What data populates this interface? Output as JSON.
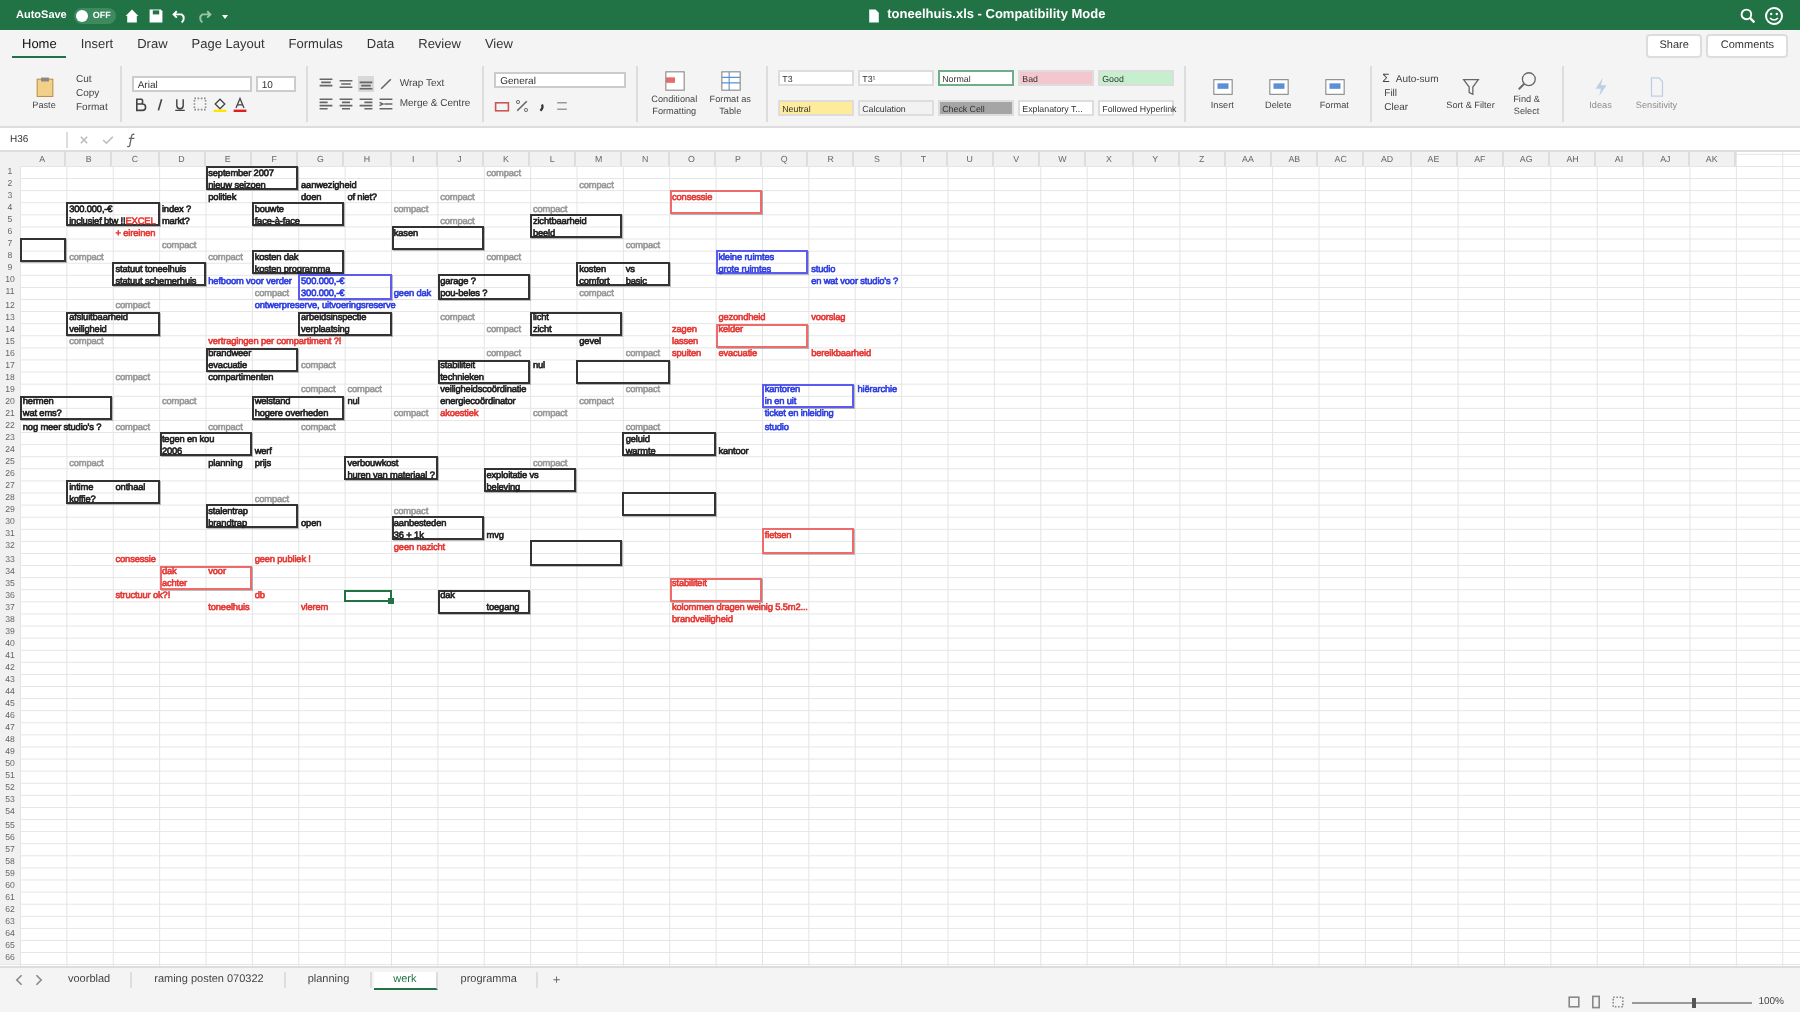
{
  "title_bar": {
    "autosave_label": "AutoSave",
    "autosave": {
      "on": false,
      "label": "OFF"
    },
    "title": "toneelhuis.xls  -  Compatibility Mode"
  },
  "tabs": [
    {
      "label": "Home",
      "selected": true
    },
    {
      "label": "Insert",
      "selected": false
    },
    {
      "label": "Draw",
      "selected": false
    },
    {
      "label": "Page Layout",
      "selected": false
    },
    {
      "label": "Formulas",
      "selected": false
    },
    {
      "label": "Data",
      "selected": false
    },
    {
      "label": "Review",
      "selected": false
    },
    {
      "label": "View",
      "selected": false
    }
  ],
  "share": "Share",
  "comments": "Comments",
  "ribbon": {
    "paste": "Paste",
    "cut": "Cut",
    "copy": "Copy",
    "format_painter": "Format",
    "font_name": "Arial",
    "font_size": "10",
    "wrap_text": "Wrap Text",
    "merge": "Merge & Centre",
    "number_format": "General",
    "conditional": "Conditional Formatting",
    "format_table": "Format as Table",
    "styles": [
      {
        "label": "T3",
        "color": "#ffffff",
        "selected": false
      },
      {
        "label": "T3¹",
        "color": "#ffffff",
        "selected": false
      },
      {
        "label": "Normal",
        "color": "#ffffff",
        "selected": true
      },
      {
        "label": "Bad",
        "color": "#f4c7ce",
        "selected": false
      },
      {
        "label": "Good",
        "color": "#c6efce",
        "selected": false
      },
      {
        "label": "Neutral",
        "color": "#ffeb9c",
        "selected": false
      },
      {
        "label": "Calculation",
        "color": "#f2f2f2",
        "selected": false
      },
      {
        "label": "Check Cell",
        "color": "#a5a5a5",
        "selected": false
      },
      {
        "label": "Explanatory T...",
        "color": "#ffffff",
        "selected": false
      },
      {
        "label": "Followed Hyperlink",
        "color": "#ffffff",
        "selected": false
      }
    ],
    "cells": [
      "Insert",
      "Delete",
      "Format"
    ],
    "autosum_symbol": "Σ",
    "autosum": "Auto-sum",
    "fill": "Fill",
    "clear": "Clear",
    "sort": "Sort & Filter",
    "find": "Find & Select",
    "ideas": "Ideas",
    "sensitivity": "Sensitivity"
  },
  "formula_bar": {
    "name_box": "H36"
  },
  "sheet": {
    "columns": [
      "A",
      "B",
      "C",
      "D",
      "E",
      "F",
      "G",
      "H",
      "I",
      "J",
      "K",
      "L",
      "M",
      "N",
      "O",
      "P",
      "Q",
      "R",
      "S",
      "T",
      "U",
      "V",
      "W",
      "X",
      "Y",
      "Z",
      "AA",
      "AB",
      "AC",
      "AD",
      "AE",
      "AF",
      "AG",
      "AH",
      "AI",
      "AJ",
      "AK"
    ],
    "rows": [
      {
        "label": "1",
        "cells": [
          {},
          {},
          {},
          {},
          {
            "text": "september 2007",
            "color": "#222222",
            "outline": {
              "color": "#333333",
              "wide": true
            }
          },
          {},
          {},
          {},
          {},
          {},
          {
            "text": "compact",
            "color": "#9a9a9a"
          }
        ]
      },
      {
        "label": "2",
        "cells": [
          {},
          {},
          {},
          {},
          {
            "text": "nieuw seizoen",
            "color": "#222222"
          },
          {},
          {
            "text": "aanwezigheid",
            "color": "#222222"
          },
          {},
          {},
          {},
          {},
          {},
          {
            "text": "compact",
            "color": "#9a9a9a"
          }
        ]
      },
      {
        "label": "3",
        "cells": [
          {},
          {},
          {},
          {},
          {
            "text": "politiek",
            "color": "#222222"
          },
          {},
          {
            "text": "doen",
            "color": "#222222"
          },
          {
            "text": "of niet?",
            "color": "#222222"
          },
          {},
          {
            "text": "compact",
            "color": "#9a9a9a"
          },
          {},
          {},
          {},
          {},
          {
            "text": "consessie",
            "color": "#e53935",
            "outline": {
              "color": "#ee6b6b",
              "wide": true
            }
          }
        ]
      },
      {
        "label": "4",
        "cells": [
          {},
          {
            "text": "300.000,-€",
            "color": "#222222",
            "outline": {
              "color": "#333333",
              "wide": true
            }
          },
          {},
          {
            "text": "index ?",
            "color": "#222222"
          },
          {},
          {
            "text": "bouwte",
            "color": "#222222",
            "outline": {
              "color": "#333333",
              "wide": true
            }
          },
          {},
          {},
          {
            "text": "compact",
            "color": "#9a9a9a"
          },
          {},
          {},
          {
            "text": "compact",
            "color": "#9a9a9a"
          }
        ]
      },
      {
        "label": "5",
        "cells": [
          {},
          {
            "text": "inclusief btw !!",
            "color": "#222222",
            "tail": {
              "text": "EXCEL",
              "color": "#e53935"
            }
          },
          {},
          {
            "text": "markt?",
            "color": "#222222"
          },
          {},
          {
            "text": "face-à-face",
            "color": "#222222"
          },
          {},
          {},
          {},
          {
            "text": "compact",
            "color": "#9a9a9a"
          },
          {},
          {
            "text": "zichtbaarheid",
            "color": "#222222",
            "outline": {
              "color": "#333333",
              "wide": true
            }
          }
        ]
      },
      {
        "label": "6",
        "cells": [
          {},
          {},
          {
            "text": "+ eireinen",
            "color": "#e53935"
          },
          {},
          {},
          {},
          {},
          {},
          {
            "text": "kasen",
            "color": "#222222",
            "outline": {
              "color": "#333333",
              "wide": true
            }
          },
          {},
          {},
          {
            "text": "beeld",
            "color": "#222222"
          }
        ]
      },
      {
        "label": "7",
        "cells": [
          {
            "outline": {
              "color": "#333333",
              "wide": false
            }
          },
          {},
          {},
          {
            "text": "compact",
            "color": "#9a9a9a"
          },
          {},
          {},
          {},
          {},
          {},
          {},
          {},
          {},
          {},
          {
            "text": "compact",
            "color": "#9a9a9a"
          }
        ]
      },
      {
        "label": "8",
        "cells": [
          {},
          {
            "text": "compact",
            "color": "#9a9a9a"
          },
          {},
          {},
          {
            "text": "compact",
            "color": "#9a9a9a"
          },
          {
            "text": "kosten dak",
            "color": "#222222",
            "outline": {
              "color": "#333333",
              "wide": true
            }
          },
          {},
          {},
          {},
          {},
          {
            "text": "compact",
            "color": "#9a9a9a"
          },
          {},
          {},
          {},
          {},
          {
            "text": "kleine ruimtes",
            "color": "#2f3fe0",
            "outline": {
              "color": "#5b5bef",
              "wide": true
            }
          }
        ]
      },
      {
        "label": "9",
        "cells": [
          {},
          {},
          {
            "text": "statuut toneelhuis",
            "color": "#222222",
            "outline": {
              "color": "#333333",
              "wide": true
            }
          },
          {},
          {},
          {
            "text": "kosten programma",
            "color": "#222222"
          },
          {},
          {},
          {},
          {},
          {},
          {},
          {
            "text": "kosten",
            "color": "#222222",
            "outline": {
              "color": "#333333",
              "wide": true
            }
          },
          {
            "text": "vs",
            "color": "#222222"
          },
          {},
          {
            "text": "grote ruimtes",
            "color": "#2f3fe0"
          },
          {},
          {
            "text": "studio",
            "color": "#2f3fe0"
          }
        ]
      },
      {
        "label": "10",
        "cells": [
          {},
          {},
          {
            "text": "statuut schemerhuis",
            "color": "#222222"
          },
          {},
          {
            "text": "hefboom voor verder",
            "color": "#2f3fe0"
          },
          {},
          {
            "text": "500.000,-€",
            "color": "#2f3fe0",
            "outline": {
              "color": "#5b5bef",
              "wide": true
            }
          },
          {},
          {},
          {
            "text": "garage ?",
            "color": "#222222",
            "outline": {
              "color": "#333333",
              "wide": true
            }
          },
          {},
          {},
          {
            "text": "comfort",
            "color": "#222222"
          },
          {
            "text": "basic",
            "color": "#222222"
          },
          {},
          {},
          {},
          {
            "text": "en wat voor studio's ?",
            "color": "#2f3fe0"
          }
        ]
      },
      {
        "label": "11",
        "cells": [
          {},
          {},
          {},
          {},
          {},
          {
            "text": "compact",
            "color": "#9a9a9a"
          },
          {
            "text": "300.000,-€",
            "color": "#2f3fe0"
          },
          {},
          {
            "text": "geen dak",
            "color": "#2f3fe0"
          },
          {
            "text": "pou-beles ?",
            "color": "#222222"
          },
          {},
          {},
          {
            "text": "compact",
            "color": "#9a9a9a"
          }
        ]
      },
      {
        "label": "12",
        "cells": [
          {},
          {},
          {
            "text": "compact",
            "color": "#9a9a9a"
          },
          {},
          {},
          {
            "text": "ontwerpreserve, uitvoeringsreserve",
            "color": "#2f3fe0"
          }
        ]
      },
      {
        "label": "13",
        "cells": [
          {},
          {
            "text": "afsluitbaarheid",
            "color": "#222222",
            "outline": {
              "color": "#333333",
              "wide": true
            }
          },
          {},
          {},
          {},
          {},
          {
            "text": "arbeidsinspectie",
            "color": "#222222",
            "outline": {
              "color": "#333333",
              "wide": true
            }
          },
          {},
          {},
          {
            "text": "compact",
            "color": "#9a9a9a"
          },
          {},
          {
            "text": "licht",
            "color": "#222222",
            "outline": {
              "color": "#333333",
              "wide": true
            }
          },
          {},
          {},
          {},
          {
            "text": "gezondheid",
            "color": "#e53935"
          },
          {},
          {
            "text": "voorslag",
            "color": "#e53935"
          }
        ]
      },
      {
        "label": "14",
        "cells": [
          {},
          {
            "text": "veiligheid",
            "color": "#222222"
          },
          {},
          {},
          {},
          {},
          {
            "text": "verplaatsing",
            "color": "#222222"
          },
          {},
          {},
          {},
          {
            "text": "compact",
            "color": "#9a9a9a"
          },
          {
            "text": "zicht",
            "color": "#222222"
          },
          {},
          {},
          {
            "text": "zagen",
            "color": "#e53935"
          },
          {
            "text": "kelder",
            "color": "#e53935",
            "outline": {
              "color": "#ee6b6b",
              "wide": true
            }
          }
        ]
      },
      {
        "label": "15",
        "cells": [
          {},
          {
            "text": "compact",
            "color": "#9a9a9a"
          },
          {},
          {},
          {
            "text": "vertragingen per compartiment ?!",
            "color": "#e53935"
          },
          {},
          {},
          {},
          {},
          {},
          {},
          {},
          {
            "text": "gevel",
            "color": "#222222"
          },
          {},
          {
            "text": "lassen",
            "color": "#e53935"
          }
        ]
      },
      {
        "label": "16",
        "cells": [
          {},
          {},
          {},
          {},
          {
            "text": "brandweer",
            "color": "#222222",
            "outline": {
              "color": "#333333",
              "wide": true
            }
          },
          {},
          {},
          {},
          {},
          {},
          {
            "text": "compact",
            "color": "#9a9a9a"
          },
          {},
          {},
          {
            "text": "compact",
            "color": "#9a9a9a"
          },
          {
            "text": "spuiten",
            "color": "#e53935"
          },
          {
            "text": "evacuatie",
            "color": "#e53935"
          },
          {},
          {
            "text": "bereikbaarheid",
            "color": "#e53935"
          }
        ]
      },
      {
        "label": "17",
        "cells": [
          {},
          {},
          {},
          {},
          {
            "text": "evacuatie",
            "color": "#222222"
          },
          {},
          {
            "text": "compact",
            "color": "#9a9a9a"
          },
          {},
          {},
          {
            "text": "stabiliteit",
            "color": "#222222",
            "outline": {
              "color": "#333333",
              "wide": true
            }
          },
          {},
          {
            "text": "nul",
            "color": "#222222"
          },
          {
            "outline": {
              "color": "#333333",
              "wide": true
            }
          }
        ]
      },
      {
        "label": "18",
        "cells": [
          {},
          {},
          {
            "text": "compact",
            "color": "#9a9a9a"
          },
          {},
          {
            "text": "compartimenten",
            "color": "#222222"
          },
          {},
          {},
          {},
          {},
          {
            "text": "technieken",
            "color": "#222222"
          }
        ]
      },
      {
        "label": "19",
        "cells": [
          {},
          {},
          {},
          {},
          {},
          {},
          {
            "text": "compact",
            "color": "#9a9a9a"
          },
          {
            "text": "compact",
            "color": "#9a9a9a"
          },
          {},
          {
            "text": "veiligheidscoördinatie",
            "color": "#222222"
          },
          {},
          {},
          {},
          {
            "text": "compact",
            "color": "#9a9a9a"
          },
          {},
          {},
          {
            "text": "kantoren",
            "color": "#2f3fe0",
            "outline": {
              "color": "#5b5bef",
              "wide": true
            }
          },
          {},
          {
            "text": "hiërarchie",
            "color": "#2f3fe0"
          }
        ]
      },
      {
        "label": "20",
        "cells": [
          {
            "text": "hermen",
            "color": "#222222",
            "outline": {
              "color": "#333333",
              "wide": true
            }
          },
          {},
          {},
          {
            "text": "compact",
            "color": "#9a9a9a"
          },
          {},
          {
            "text": "welstand",
            "color": "#222222",
            "outline": {
              "color": "#333333",
              "wide": true
            }
          },
          {},
          {
            "text": "nul",
            "color": "#222222"
          },
          {},
          {
            "text": "energiecoördinator",
            "color": "#222222"
          },
          {},
          {},
          {
            "text": "compact",
            "color": "#9a9a9a"
          },
          {},
          {},
          {},
          {
            "text": "in en uit",
            "color": "#2f3fe0"
          }
        ]
      },
      {
        "label": "21",
        "cells": [
          {
            "text": "wat ems?",
            "color": "#222222"
          },
          {},
          {},
          {},
          {},
          {
            "text": "hogere overheden",
            "color": "#222222"
          },
          {},
          {},
          {
            "text": "compact",
            "color": "#9a9a9a"
          },
          {
            "text": "akoestiek",
            "color": "#e53935"
          },
          {},
          {
            "text": "compact",
            "color": "#9a9a9a"
          },
          {},
          {},
          {},
          {},
          {
            "text": "ticket en inleiding",
            "color": "#2f3fe0"
          }
        ]
      },
      {
        "label": "22",
        "cells": [
          {
            "text": "nog meer studio's ?",
            "color": "#222222"
          },
          {},
          {
            "text": "compact",
            "color": "#9a9a9a"
          },
          {},
          {
            "text": "compact",
            "color": "#9a9a9a"
          },
          {},
          {
            "text": "compact",
            "color": "#9a9a9a"
          },
          {},
          {},
          {},
          {},
          {},
          {},
          {
            "text": "compact",
            "color": "#9a9a9a"
          },
          {},
          {},
          {
            "text": "studio",
            "color": "#2f3fe0"
          }
        ]
      },
      {
        "label": "23",
        "cells": [
          {},
          {},
          {},
          {
            "text": "tegen en kou",
            "color": "#222222",
            "outline": {
              "color": "#333333",
              "wide": true
            }
          },
          {},
          {},
          {},
          {},
          {},
          {},
          {},
          {},
          {},
          {
            "text": "geluid",
            "color": "#222222",
            "outline": {
              "color": "#333333",
              "wide": true
            }
          }
        ]
      },
      {
        "label": "24",
        "cells": [
          {},
          {},
          {},
          {
            "text": "2006",
            "color": "#222222"
          },
          {},
          {
            "text": "werf",
            "color": "#222222"
          },
          {},
          {},
          {},
          {},
          {},
          {},
          {},
          {
            "text": "warmte",
            "color": "#222222"
          },
          {},
          {
            "text": "kantoor",
            "color": "#222222"
          }
        ]
      },
      {
        "label": "25",
        "cells": [
          {},
          {
            "text": "compact",
            "color": "#9a9a9a"
          },
          {},
          {},
          {
            "text": "planning",
            "color": "#222222"
          },
          {
            "text": "prijs",
            "color": "#222222"
          },
          {},
          {
            "text": "verbouwkost",
            "color": "#222222",
            "outline": {
              "color": "#333333",
              "wide": true
            }
          },
          {},
          {},
          {},
          {
            "text": "compact",
            "color": "#9a9a9a"
          }
        ]
      },
      {
        "label": "26",
        "cells": [
          {},
          {},
          {},
          {},
          {},
          {},
          {},
          {
            "text": "huren van materiaal ?",
            "color": "#222222"
          },
          {},
          {},
          {
            "text": "exploitatie  vs",
            "color": "#222222",
            "outline": {
              "color": "#333333",
              "wide": true
            }
          }
        ]
      },
      {
        "label": "27",
        "cells": [
          {},
          {
            "text": "intime",
            "color": "#222222",
            "outline": {
              "color": "#333333",
              "wide": true
            }
          },
          {
            "text": "onthaal",
            "color": "#222222"
          },
          {},
          {},
          {},
          {},
          {},
          {},
          {},
          {
            "text": "beleving",
            "color": "#222222"
          }
        ]
      },
      {
        "label": "28",
        "cells": [
          {},
          {
            "text": "koffie?",
            "color": "#222222"
          },
          {},
          {},
          {},
          {
            "text": "compact",
            "color": "#9a9a9a"
          },
          {},
          {},
          {},
          {},
          {},
          {},
          {},
          {
            "outline": {
              "color": "#333333",
              "wide": true
            }
          }
        ]
      },
      {
        "label": "29",
        "cells": [
          {},
          {},
          {},
          {},
          {
            "text": "stalentrap",
            "color": "#222222",
            "outline": {
              "color": "#333333",
              "wide": true
            }
          },
          {},
          {},
          {},
          {
            "text": "compact",
            "color": "#9a9a9a"
          }
        ]
      },
      {
        "label": "30",
        "cells": [
          {},
          {},
          {},
          {},
          {
            "text": "brandtrap",
            "color": "#222222"
          },
          {},
          {
            "text": "open",
            "color": "#222222"
          },
          {},
          {
            "text": "aanbesteden",
            "color": "#222222",
            "outline": {
              "color": "#333333",
              "wide": true
            }
          }
        ]
      },
      {
        "label": "31",
        "cells": [
          {},
          {},
          {},
          {},
          {},
          {},
          {},
          {},
          {
            "text": "36 + 1k",
            "color": "#222222"
          },
          {},
          {
            "text": "mvg",
            "color": "#222222"
          },
          {},
          {},
          {},
          {},
          {},
          {
            "text": "fietsen",
            "color": "#e53935",
            "outline": {
              "color": "#ee6b6b",
              "wide": true
            }
          }
        ]
      },
      {
        "label": "32",
        "cells": [
          {},
          {},
          {},
          {},
          {},
          {},
          {},
          {},
          {
            "text": "geen nazicht",
            "color": "#e53935"
          },
          {},
          {},
          {
            "outline": {
              "color": "#333333",
              "wide": true
            }
          }
        ]
      },
      {
        "label": "33",
        "cells": [
          {},
          {},
          {
            "text": "consessie",
            "color": "#e53935"
          },
          {},
          {},
          {
            "text": "geen publiek !",
            "color": "#e53935"
          }
        ]
      },
      {
        "label": "34",
        "cells": [
          {},
          {},
          {},
          {
            "text": "dak",
            "color": "#e53935",
            "outline": {
              "color": "#ee6b6b",
              "wide": true
            }
          },
          {
            "text": "voor",
            "color": "#e53935"
          }
        ]
      },
      {
        "label": "35",
        "cells": [
          {},
          {},
          {},
          {
            "text": "achter",
            "color": "#e53935"
          },
          {},
          {},
          {},
          {},
          {},
          {},
          {},
          {},
          {},
          {},
          {
            "text": "stabiliteit",
            "color": "#e53935",
            "outline": {
              "color": "#ee6b6b",
              "wide": true
            }
          }
        ]
      },
      {
        "label": "36",
        "cells": [
          {},
          {},
          {
            "text": "structuur ok?!",
            "color": "#e53935"
          },
          {},
          {},
          {
            "text": "db",
            "color": "#e53935"
          },
          {},
          {
            "selected": true
          },
          {},
          {
            "text": "dak",
            "color": "#222222",
            "outline": {
              "color": "#333333",
              "wide": true
            }
          }
        ]
      },
      {
        "label": "37",
        "cells": [
          {},
          {},
          {},
          {},
          {
            "text": "toneelhuis",
            "color": "#e53935"
          },
          {},
          {
            "text": "vlerem",
            "color": "#e53935"
          },
          {},
          {},
          {},
          {
            "text": "toegang",
            "color": "#222222"
          },
          {},
          {},
          {},
          {
            "text": "kolommen dragen weinig 5.5m2...",
            "color": "#e53935"
          }
        ]
      },
      {
        "label": "38",
        "cells": [
          {},
          {},
          {},
          {},
          {},
          {},
          {},
          {},
          {},
          {},
          {},
          {},
          {},
          {},
          {
            "text": "brandveiligheid",
            "color": "#e53935"
          }
        ]
      },
      {
        "label": "39"
      },
      {
        "label": "40"
      },
      {
        "label": "41"
      },
      {
        "label": "42"
      },
      {
        "label": "43"
      },
      {
        "label": "44"
      },
      {
        "label": "45"
      },
      {
        "label": "46"
      },
      {
        "label": "47"
      },
      {
        "label": "48"
      },
      {
        "label": "49"
      },
      {
        "label": "50"
      },
      {
        "label": "51"
      },
      {
        "label": "52"
      },
      {
        "label": "53"
      },
      {
        "label": "54"
      },
      {
        "label": "55"
      },
      {
        "label": "56"
      },
      {
        "label": "57"
      },
      {
        "label": "58"
      },
      {
        "label": "59"
      },
      {
        "label": "60"
      },
      {
        "label": "61"
      },
      {
        "label": "62"
      },
      {
        "label": "63"
      },
      {
        "label": "64"
      },
      {
        "label": "65"
      },
      {
        "label": "66"
      }
    ]
  },
  "sheet_tabs": [
    {
      "label": "voorblad",
      "selected": false
    },
    {
      "label": "raming posten 070322",
      "selected": false
    },
    {
      "label": "planning",
      "selected": false
    },
    {
      "label": "werk",
      "selected": true
    },
    {
      "label": "programma",
      "selected": false
    }
  ],
  "add_sheet": "+",
  "status_bar": {
    "zoom_slider": {
      "level": 0.5
    },
    "zoom": "100%"
  }
}
